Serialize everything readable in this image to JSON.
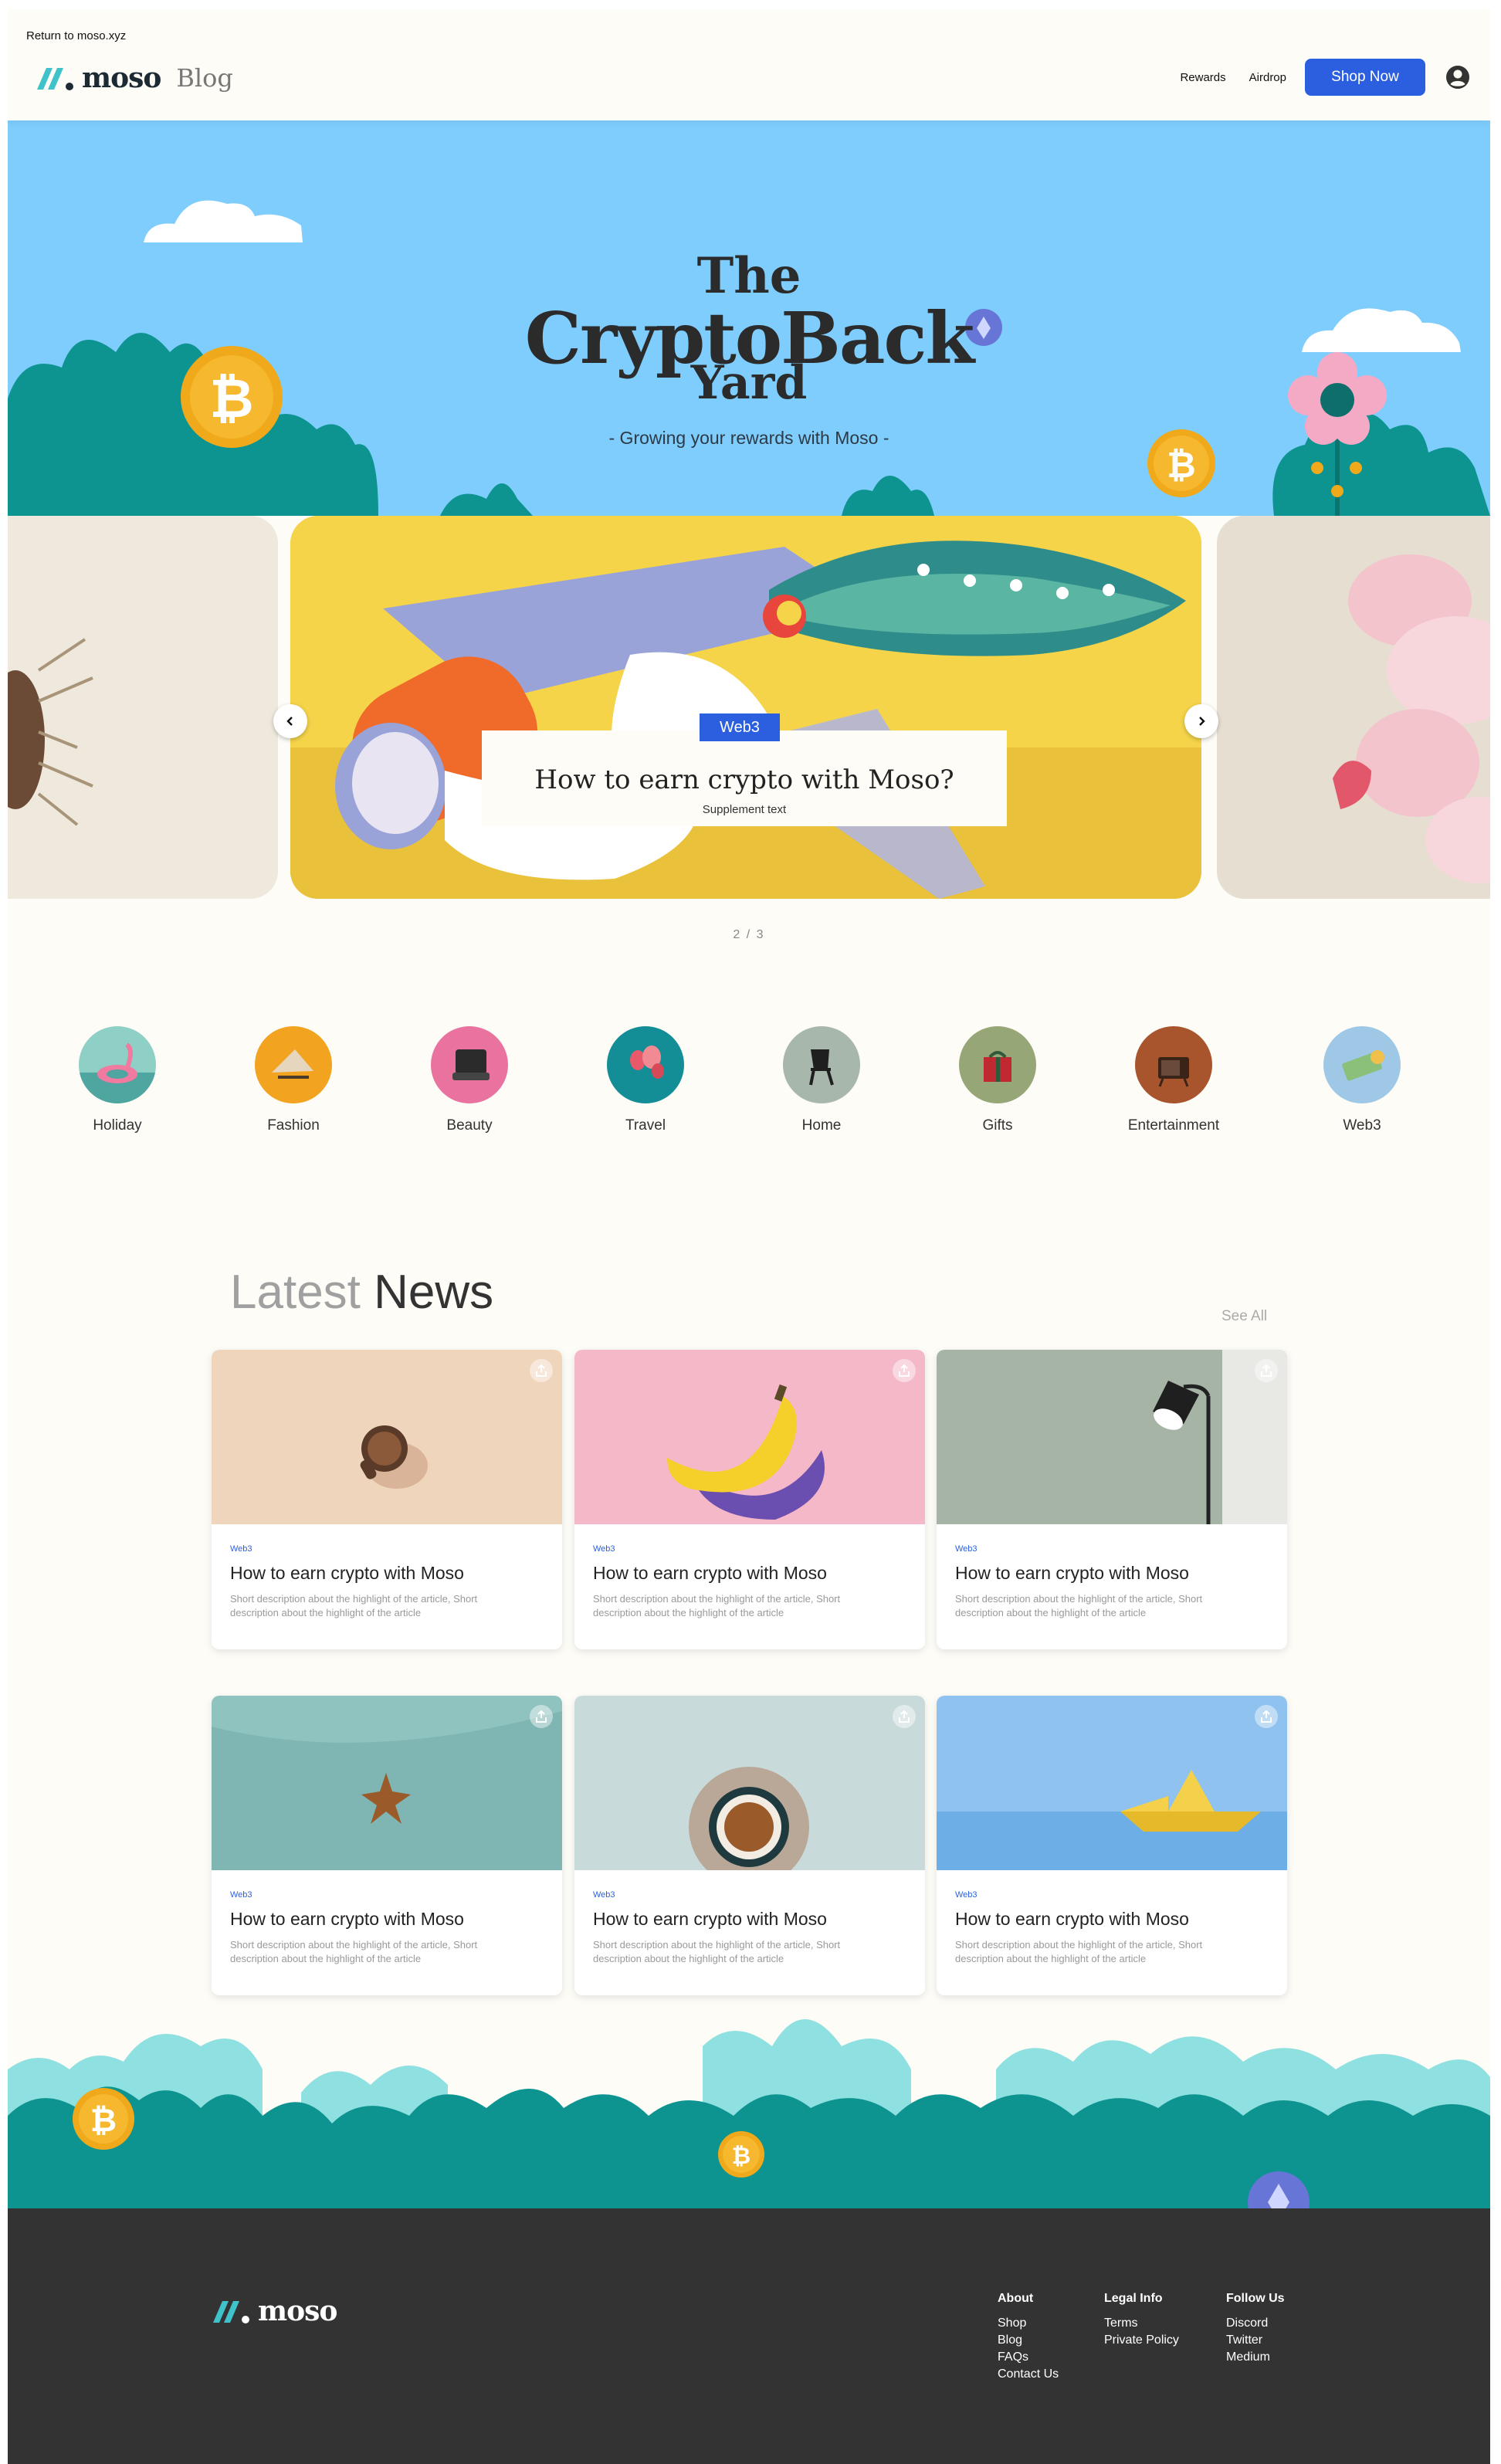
{
  "header": {
    "return_link": "Return to moso.xyz",
    "logo_text": "moso",
    "blog_label": "Blog",
    "nav": [
      "Rewards",
      "Airdrop"
    ],
    "shop_button": "Shop Now"
  },
  "hero": {
    "title_line1": "The",
    "title_line2": "CryptoBack",
    "title_line3": "Yard",
    "subtitle": "- Growing your rewards with Moso -"
  },
  "carousel": {
    "tag": "Web3",
    "title": "How to earn crypto with Moso?",
    "supplement": "Supplement text",
    "pager": "2 / 3",
    "prev_icon": "chevron-left-icon",
    "next_icon": "chevron-right-icon"
  },
  "categories": [
    "Holiday",
    "Fashion",
    "Beauty",
    "Travel",
    "Home",
    "Gifts",
    "Entertainment",
    "Web3"
  ],
  "news": {
    "heading_light": "Latest",
    "heading_dark": "News",
    "see_all": "See All",
    "cards": [
      {
        "tag": "Web3",
        "title": "How to earn crypto with Moso",
        "desc": "Short description about the highlight of the article, Short description about the highlight of the article"
      },
      {
        "tag": "Web3",
        "title": "How to earn crypto with Moso",
        "desc": "Short description about the highlight of the article, Short description about the highlight of the article"
      },
      {
        "tag": "Web3",
        "title": "How to earn crypto with Moso",
        "desc": "Short description about the highlight of the article, Short description about the highlight of the article"
      },
      {
        "tag": "Web3",
        "title": "How to earn crypto with Moso",
        "desc": "Short description about the highlight of the article, Short description about the highlight of the article"
      },
      {
        "tag": "Web3",
        "title": "How to earn crypto with Moso",
        "desc": "Short description about the highlight of the article, Short description about the highlight of the article"
      },
      {
        "tag": "Web3",
        "title": "How to earn crypto with Moso",
        "desc": "Short description about the highlight of the article, Short description about the highlight of the article"
      }
    ]
  },
  "footer": {
    "logo_text": "moso",
    "columns": [
      {
        "title": "About",
        "links": [
          "Shop",
          "Blog",
          "FAQs",
          "Contact Us"
        ]
      },
      {
        "title": "Legal Info",
        "links": [
          "Terms",
          "Private Policy"
        ]
      },
      {
        "title": "Follow Us",
        "links": [
          "Discord",
          "Twitter",
          "Medium"
        ]
      }
    ]
  },
  "colors": {
    "accent": "#2b5fe0",
    "sky": "#7ecdfd",
    "foliage": "#0d9490",
    "foliage_light": "#8fe0e0",
    "coin": "#f0a91a",
    "footer_bg": "#333333",
    "page_bg": "#fdfcf7"
  }
}
